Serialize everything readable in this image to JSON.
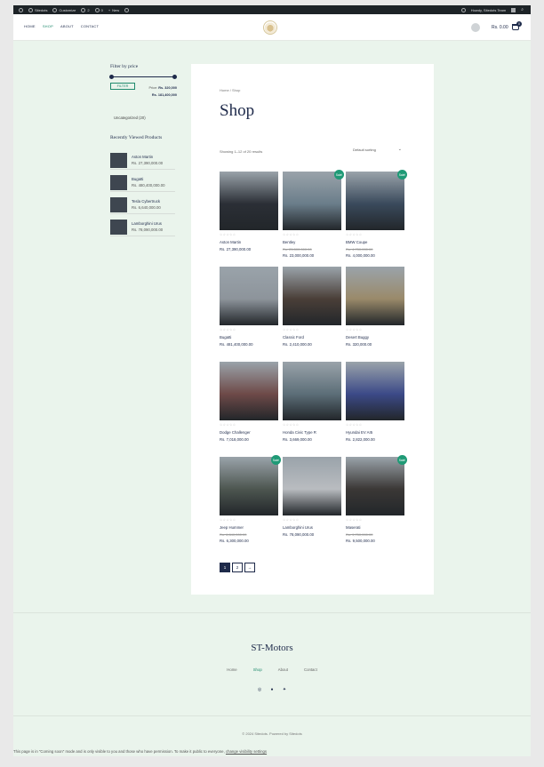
{
  "admin_bar": {
    "items": [
      "Sitedots",
      "Customize",
      "2",
      "0",
      "New"
    ],
    "right_label": "Howdy, Sitedots Team"
  },
  "header": {
    "nav": [
      "HOME",
      "SHOP",
      "ABOUT",
      "CONTACT"
    ],
    "active_nav": "SHOP",
    "cart_total": "Rs. 0.00",
    "cart_count": "0"
  },
  "sidebar": {
    "filter_title": "Filter by price",
    "filter_button": "FILTER",
    "price_from_label": "Price:",
    "price_min": "Rs. 320,000",
    "price_max": "Rs. 181,400,000",
    "category": "Uncategorized (20)",
    "recently_viewed_title": "Recently Viewed Products",
    "recently_viewed": [
      {
        "name": "Aston Martin",
        "price": "Rs. 27,390,000.00"
      },
      {
        "name": "Bugatti",
        "price": "Rs. 480,400,000.00"
      },
      {
        "name": "Tesla Cybertruck",
        "price": "Rs. 6,640,000.00"
      },
      {
        "name": "Lamborghini Urus",
        "price": "Rs. 78,090,000.00"
      }
    ]
  },
  "main": {
    "breadcrumb": "Home / Shop",
    "title": "Shop",
    "result_count": "Showing 1–12 of 20 results",
    "sort_label": "Default sorting",
    "sale_badge": "Sale!",
    "stars": "☆☆☆☆☆",
    "products": [
      {
        "name": "Aston Martin",
        "price": "Rs. 27,390,000.00",
        "sale": false,
        "old_price": ""
      },
      {
        "name": "Bentley",
        "price": "Rs. 23,000,000.00",
        "sale": true,
        "old_price": "Rs. 25,500,000.00"
      },
      {
        "name": "BMW Coupe",
        "price": "Rs. 4,000,000.00",
        "sale": true,
        "old_price": "Rs. 4,750,000.00"
      },
      {
        "name": "Bugatti",
        "price": "Rs. 481,400,000.00",
        "sale": false,
        "old_price": ""
      },
      {
        "name": "Classic Ford",
        "price": "Rs. 2,410,000.00",
        "sale": false,
        "old_price": ""
      },
      {
        "name": "Desert Buggy",
        "price": "Rs. 320,000.00",
        "sale": false,
        "old_price": ""
      },
      {
        "name": "Dodge Challenger",
        "price": "Rs. 7,018,000.00",
        "sale": false,
        "old_price": ""
      },
      {
        "name": "Honda Civic Type R",
        "price": "Rs. 3,669,000.00",
        "sale": false,
        "old_price": ""
      },
      {
        "name": "Hyundai EV AI5",
        "price": "Rs. 2,822,000.00",
        "sale": false,
        "old_price": ""
      },
      {
        "name": "Jeep Hummer",
        "price": "Rs. 6,300,000.00",
        "sale": true,
        "old_price": "Rs. 6,840,000.00"
      },
      {
        "name": "Lamborghini Urus",
        "price": "Rs. 78,090,000.00",
        "sale": false,
        "old_price": ""
      },
      {
        "name": "Maserati",
        "price": "Rs. 9,500,000.00",
        "sale": true,
        "old_price": "Rs. 9,750,000.00"
      }
    ],
    "pagination": [
      "1",
      "2",
      "→"
    ]
  },
  "footer": {
    "title": "ST-Motors",
    "nav": [
      "Home",
      "Shop",
      "About",
      "Contact"
    ],
    "active_nav": "Shop",
    "copyright": "© 2024 Sitedots. Powered by Sitedots"
  },
  "notice": {
    "text": "This page is in \"Coming soon\" mode and is only visible to you and those who have permission. To make it public to everyone,",
    "link": "change visibility settings"
  }
}
